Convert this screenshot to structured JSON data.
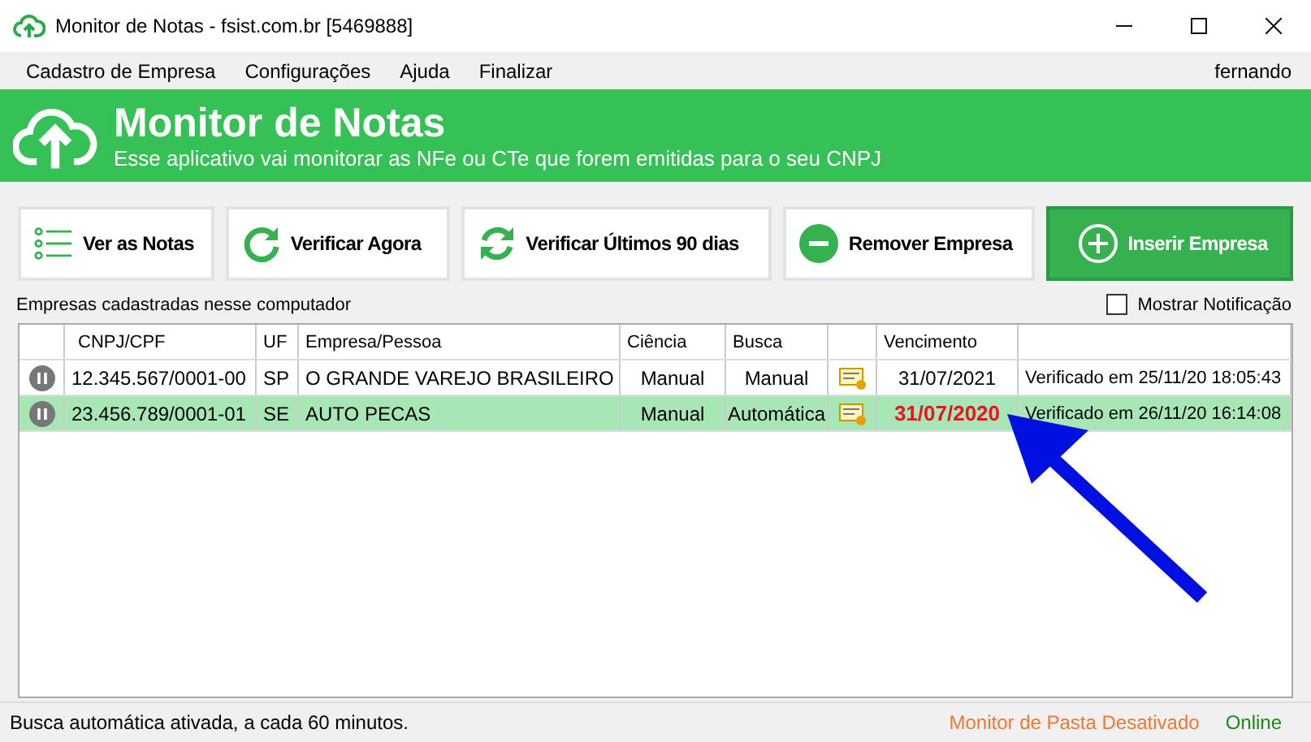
{
  "window": {
    "title": "Monitor de Notas - fsist.com.br [5469888]"
  },
  "menu": [
    {
      "label": "Cadastro de Empresa"
    },
    {
      "label": "Configurações"
    },
    {
      "label": "Ajuda"
    },
    {
      "label": "Finalizar"
    }
  ],
  "user": "fernando",
  "header": {
    "title": "Monitor de Notas",
    "subtitle": "Esse aplicativo vai monitorar as NFe ou CTe que forem emitidas para o seu CNPJ"
  },
  "toolbar": [
    {
      "label": "Ver as Notas",
      "kind": "list"
    },
    {
      "label": "Verificar Agora",
      "kind": "refresh"
    },
    {
      "label": "Verificar Últimos 90 dias",
      "kind": "sync"
    },
    {
      "label": "Remover Empresa",
      "kind": "remove"
    },
    {
      "label": "Inserir Empresa",
      "kind": "add"
    }
  ],
  "list_caption": "Empresas cadastradas nesse computador",
  "notification": {
    "label": "Mostrar Notificação",
    "checked": false
  },
  "table": {
    "columns": [
      "CNPJ/CPF",
      "UF",
      "Empresa/Pessoa",
      "Ciência",
      "Busca",
      "Vencimento"
    ],
    "rows": [
      {
        "cnpj": "12.345.567/0001-00",
        "uf": "SP",
        "empresa": "O GRANDE VAREJO BRASILEIRO",
        "ciencia": "Manual",
        "busca": "Manual",
        "vencimento": "31/07/2021",
        "expired": false,
        "status": "Verificado em 25/11/20 18:05:43",
        "selected": false
      },
      {
        "cnpj": "23.456.789/0001-01",
        "uf": "SE",
        "empresa": "AUTO PECAS",
        "ciencia": "Manual",
        "busca": "Automática",
        "vencimento": "31/07/2020",
        "expired": true,
        "status": "Verificado em 26/11/20 16:14:08",
        "selected": true
      }
    ]
  },
  "status_bar": {
    "message": "Busca automática ativada, a cada 60 minutos.",
    "folder_monitor": "Monitor de Pasta Desativado",
    "connection": "Online"
  }
}
